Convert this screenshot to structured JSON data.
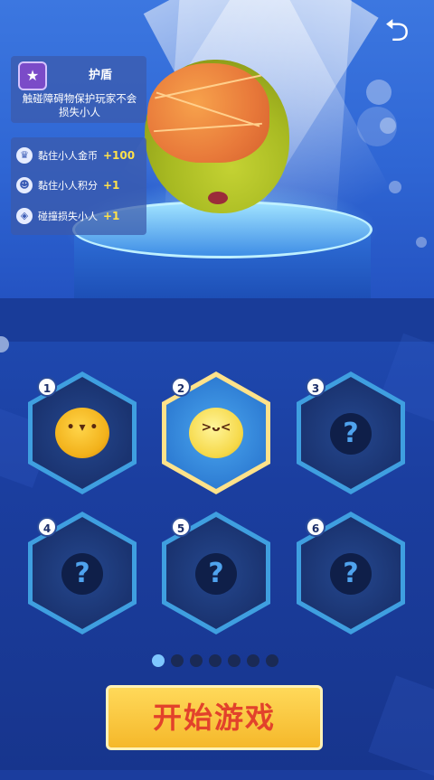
{
  "header": {
    "back_icon": "back-arrow-icon"
  },
  "shield": {
    "icon": "shield-star-icon",
    "title": "护盾",
    "description": "触碰障碍物保护玩家不会损失小人"
  },
  "bonuses": [
    {
      "icon": "crown-icon",
      "label": "黏住小人金币",
      "value": "+100"
    },
    {
      "icon": "user-add-icon",
      "label": "黏住小人积分",
      "value": "+1"
    },
    {
      "icon": "shield-icon",
      "label": "碰撞损失小人",
      "value": "+1"
    }
  ],
  "slots": [
    {
      "number": "1",
      "state": "unlocked",
      "character": "chick"
    },
    {
      "number": "2",
      "state": "selected",
      "character": "fruit"
    },
    {
      "number": "3",
      "state": "locked",
      "symbol": "?"
    },
    {
      "number": "4",
      "state": "locked",
      "symbol": "?"
    },
    {
      "number": "5",
      "state": "locked",
      "symbol": "?"
    },
    {
      "number": "6",
      "state": "locked",
      "symbol": "?"
    }
  ],
  "pagination": {
    "current": 1,
    "total": 7
  },
  "start_button": {
    "label": "开始游戏"
  },
  "colors": {
    "accent": "#f5b82a",
    "start_text": "#e2422b",
    "bonus_value": "#ffe14a"
  }
}
